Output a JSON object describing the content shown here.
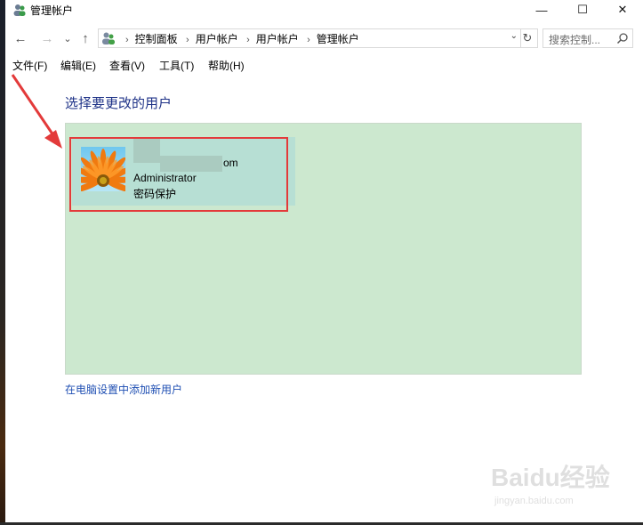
{
  "window": {
    "title": "管理帐户",
    "controls": {
      "minimize": "—",
      "maximize": "☐",
      "close": "✕"
    }
  },
  "nav": {
    "back": "←",
    "forward": "→",
    "recent": "⌄",
    "up": "↑",
    "breadcrumbs": [
      "控制面板",
      "用户帐户",
      "用户帐户",
      "管理帐户"
    ],
    "separator": "›",
    "dropdown": "⌄",
    "refresh": "↻"
  },
  "search": {
    "placeholder": "搜索控制..."
  },
  "menu": [
    "文件(F)",
    "编辑(E)",
    "查看(V)",
    "工具(T)",
    "帮助(H)"
  ],
  "main": {
    "heading": "选择要更改的用户",
    "user": {
      "email_visible": "om",
      "account_type": "Administrator",
      "status": "密码保护"
    },
    "add_user_link": "在电脑设置中添加新用户"
  },
  "watermark": {
    "brand": "Baidu经验",
    "url": "jingyan.baidu.com"
  },
  "colors": {
    "panel": "#cce8cf",
    "tile": "#b7dfd4",
    "highlight": "#e33a3a",
    "heading": "#1e3287",
    "link": "#1f4fb3"
  }
}
